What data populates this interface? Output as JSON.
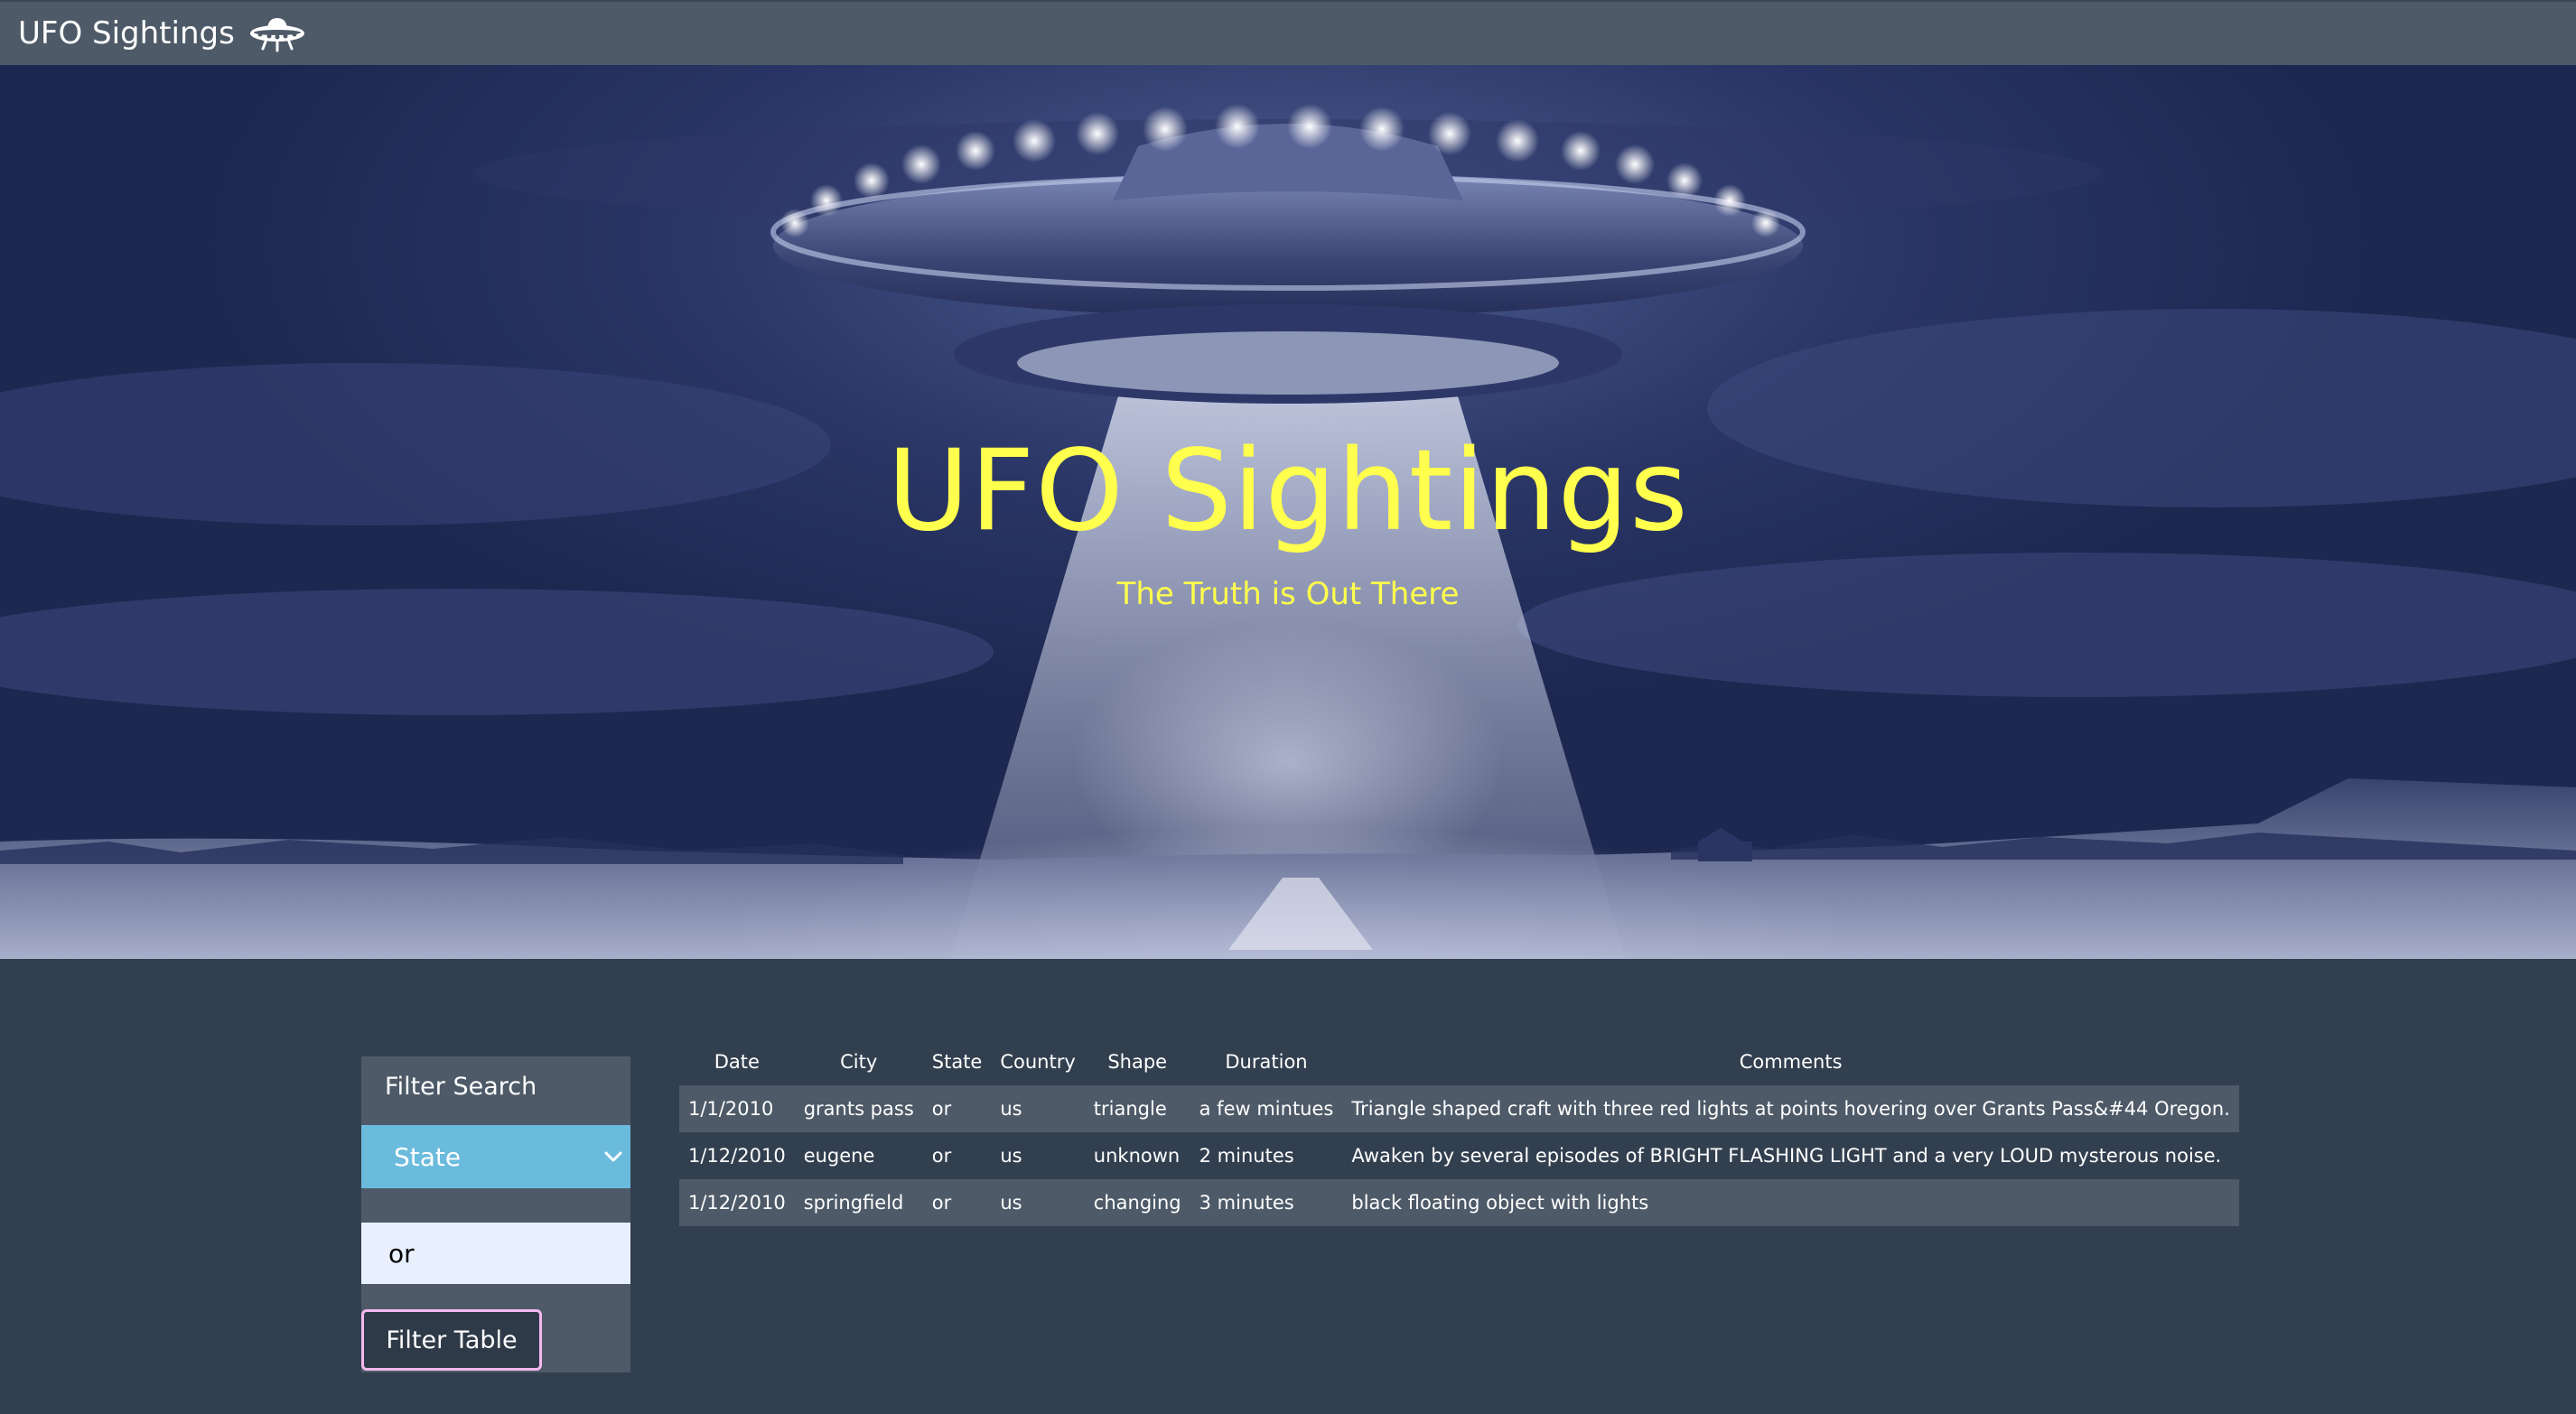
{
  "navbar": {
    "brand": "UFO Sightings",
    "brand_icon": "flying-saucer-icon"
  },
  "hero": {
    "title": "UFO Sightings",
    "subtitle": "The Truth is Out There",
    "title_color": "#ffff4d"
  },
  "filter": {
    "heading": "Filter Search",
    "select_value": "State",
    "input_value": "or",
    "button_label": "Filter Table",
    "select_color": "#6bbbdd"
  },
  "table": {
    "headers": [
      "Date",
      "City",
      "State",
      "Country",
      "Shape",
      "Duration",
      "Comments"
    ],
    "rows": [
      [
        "1/1/2010",
        "grants pass",
        "or",
        "us",
        "triangle",
        "a few mintues",
        "Triangle shaped craft with three red lights at points hovering over Grants Pass&#44 Oregon."
      ],
      [
        "1/12/2010",
        "eugene",
        "or",
        "us",
        "unknown",
        "2 minutes",
        "Awaken by several episodes of BRIGHT FLASHING LIGHT and a very LOUD mysterous noise."
      ],
      [
        "1/12/2010",
        "springfield",
        "or",
        "us",
        "changing",
        "3 minutes",
        "black floating object with lights"
      ]
    ]
  }
}
